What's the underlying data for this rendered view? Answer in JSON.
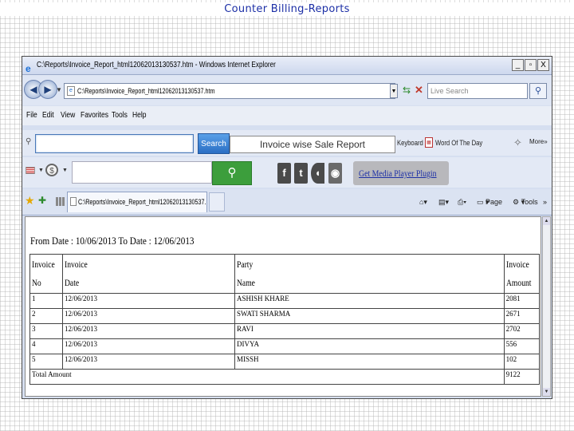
{
  "slide": {
    "title": "Counter Billing-Reports"
  },
  "window": {
    "title": "C:\\Reports\\Invoice_Report_html12062013130537.htm - Windows Internet Explorer",
    "min": "_",
    "max": "▫",
    "close": "X"
  },
  "nav": {
    "address": "C:\\Reports\\Invoice_Report_html12062013130537.htm",
    "live_search_placeholder": "Live Search"
  },
  "menu": {
    "items": [
      "File",
      "Edit",
      "View",
      "Favorites",
      "Tools",
      "Help"
    ]
  },
  "toolbar": {
    "search_button": "Search",
    "report_label": "Invoice wise Sale Report",
    "keyboard": "Keyboard",
    "word_of_the_day": "Word Of The Day",
    "more": "More»"
  },
  "toolbar2": {
    "media_link": "Get Media Player Plugin"
  },
  "tabs": {
    "active_tab": "C:\\Reports\\Invoice_Report_html12062013130537.htm",
    "page_label": "Page",
    "tools_label": "Tools"
  },
  "report": {
    "date_range": "From Date : 10/06/2013 To Date : 12/06/2013",
    "headers": [
      [
        "Invoice",
        "No"
      ],
      [
        "Invoice",
        "Date"
      ],
      [
        "Party",
        "Name"
      ],
      [
        "Invoice",
        "Amount"
      ]
    ],
    "rows": [
      [
        "1",
        "12/06/2013",
        "ASHISH KHARE",
        "2081"
      ],
      [
        "2",
        "12/06/2013",
        "SWATI SHARMA",
        "2671"
      ],
      [
        "3",
        "12/06/2013",
        "RAVI",
        "2702"
      ],
      [
        "4",
        "12/06/2013",
        "DIVYA",
        "556"
      ],
      [
        "5",
        "12/06/2013",
        "MISSH",
        "102"
      ]
    ],
    "total_label": "Total Amount",
    "total_value": "9122"
  },
  "colors": {
    "title_blue": "#1c2fa6",
    "search_button": "#2a6ec4",
    "green_search": "#3c9e3c",
    "link_blue": "#1c2fa6"
  },
  "icons": [
    "ie-logo-icon",
    "back-icon",
    "forward-icon",
    "page-icon",
    "go-icon",
    "stop-icon",
    "search-icon",
    "calendar-icon",
    "sparkle-icon",
    "flag-icon",
    "dollar-icon",
    "facebook-icon",
    "twitter-icon",
    "phone-icon",
    "wifi-icon",
    "star-icon",
    "add-favorite-icon",
    "home-icon",
    "feeds-icon",
    "print-icon"
  ]
}
